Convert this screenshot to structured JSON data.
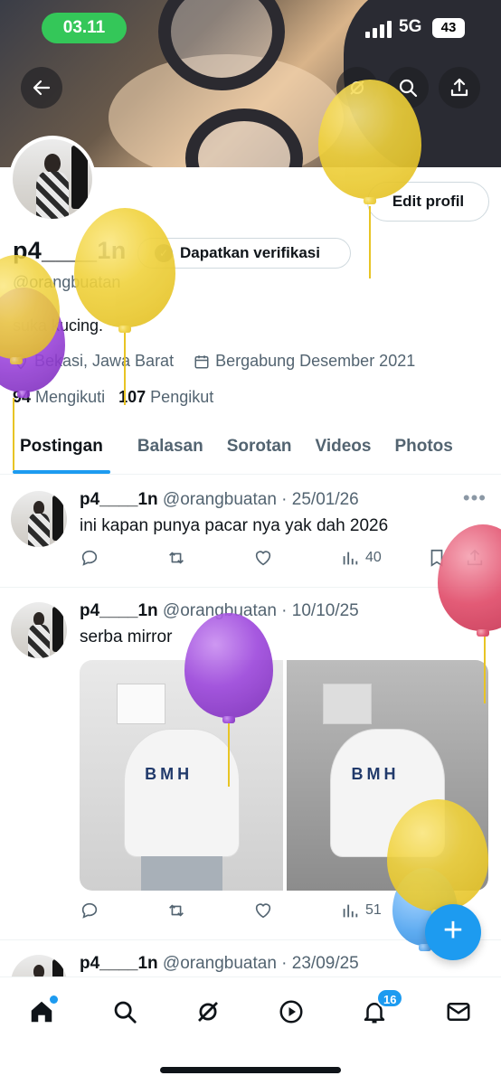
{
  "status_bar": {
    "time": "03.11",
    "network": "5G",
    "battery": "43"
  },
  "profile": {
    "edit_label": "Edit profil",
    "name": "p4____1n",
    "verify_label": "Dapatkan verifikasi",
    "handle": "@orangbuatan",
    "bio": "suka kucing.",
    "location": "Bekasi, Jawa Barat",
    "joined": "Bergabung Desember 2021",
    "following_count": "94",
    "following_label": "Mengikuti",
    "followers_count": "107",
    "followers_label": "Pengikut"
  },
  "tabs": [
    {
      "label": "Postingan",
      "active": true
    },
    {
      "label": "Balasan"
    },
    {
      "label": "Sorotan"
    },
    {
      "label": "Videos"
    },
    {
      "label": "Photos"
    }
  ],
  "posts": [
    {
      "name": "p4____1n",
      "meta": "@orangbuatan · 25/01/26",
      "text": "ini kapan punya pacar nya yak dah 2026",
      "views": "40"
    },
    {
      "name": "p4____1n",
      "meta": "@orangbuatan · 10/10/25",
      "text": "serba mirror",
      "views": "51"
    },
    {
      "name": "p4____1n",
      "meta": "@orangbuatan · 23/09/25",
      "text": ""
    }
  ],
  "notifications_badge": "16",
  "icons": {
    "back": "arrow-left-icon",
    "grok": "grok-icon",
    "search": "search-icon",
    "share": "share-icon",
    "home": "home-icon",
    "explore": "search-icon",
    "grok_nav": "grok-icon",
    "video": "play-icon",
    "notifications": "bell-icon",
    "messages": "mail-icon"
  },
  "colors": {
    "accent": "#1d9bf0",
    "status_pill": "#34c759",
    "text_secondary": "#536471"
  }
}
